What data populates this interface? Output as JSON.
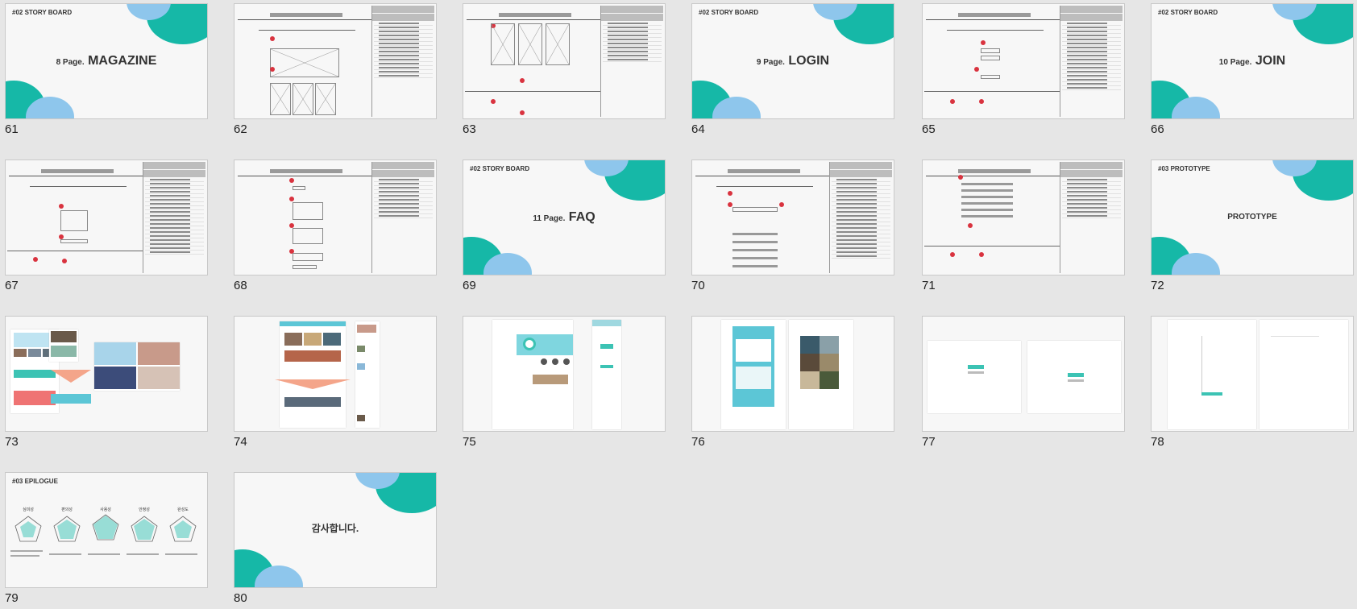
{
  "colors": {
    "background": "#e6e6e6",
    "teal": "#16b8a7",
    "blue": "#8ec6ec",
    "marker": "#d9333f"
  },
  "slides": [
    {
      "num": "61",
      "kind": "title",
      "section": "#02 STORY BOARD",
      "small": "8 Page.",
      "big": "MAGAZINE"
    },
    {
      "num": "62",
      "kind": "wireframe"
    },
    {
      "num": "63",
      "kind": "wireframe"
    },
    {
      "num": "64",
      "kind": "title",
      "section": "#02 STORY BOARD",
      "small": "9 Page.",
      "big": "LOGIN"
    },
    {
      "num": "65",
      "kind": "wireframe"
    },
    {
      "num": "66",
      "kind": "title",
      "section": "#02 STORY BOARD",
      "small": "10 Page.",
      "big": "JOIN"
    },
    {
      "num": "67",
      "kind": "wireframe"
    },
    {
      "num": "68",
      "kind": "wireframe"
    },
    {
      "num": "69",
      "kind": "title",
      "section": "#02 STORY BOARD",
      "small": "11 Page.",
      "big": "FAQ"
    },
    {
      "num": "70",
      "kind": "wireframe"
    },
    {
      "num": "71",
      "kind": "wireframe"
    },
    {
      "num": "72",
      "kind": "title",
      "section": "#03 PROTOTYPE",
      "small": "",
      "big": "PROTOTYPE"
    },
    {
      "num": "73",
      "kind": "prototype"
    },
    {
      "num": "74",
      "kind": "prototype"
    },
    {
      "num": "75",
      "kind": "prototype"
    },
    {
      "num": "76",
      "kind": "prototype"
    },
    {
      "num": "77",
      "kind": "prototype"
    },
    {
      "num": "78",
      "kind": "prototype"
    },
    {
      "num": "79",
      "kind": "epilogue",
      "section": "#03 EPILOGUE",
      "radar_labels": [
        "심미성",
        "편의성",
        "사용성",
        "안정성",
        "완성도"
      ]
    },
    {
      "num": "80",
      "kind": "closing",
      "text": "감사합니다."
    }
  ]
}
